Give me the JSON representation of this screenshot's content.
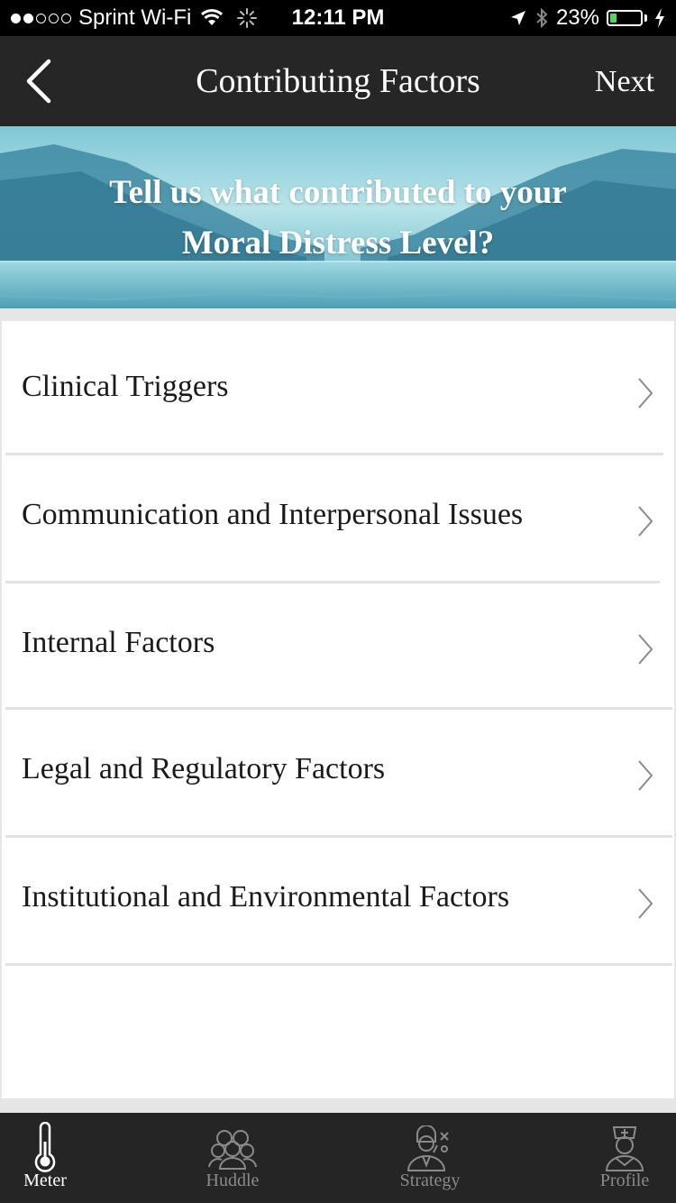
{
  "status_bar": {
    "carrier": "Sprint Wi-Fi",
    "time": "12:11 PM",
    "battery_percent": "23%",
    "battery_level": 0.23,
    "icons": [
      "wifi-icon",
      "activity-spinner-icon",
      "location-arrow-icon",
      "bluetooth-icon",
      "battery-icon",
      "charging-bolt-icon"
    ]
  },
  "nav": {
    "title": "Contributing Factors",
    "next_label": "Next",
    "back_icon": "chevron-left-icon"
  },
  "hero": {
    "line1": "Tell us what contributed to your",
    "line2": "Moral Distress Level?"
  },
  "list": {
    "items": [
      {
        "label": "Clinical Triggers"
      },
      {
        "label": "Communication and Interpersonal Issues"
      },
      {
        "label": "Internal Factors"
      },
      {
        "label": "Legal and Regulatory Factors"
      },
      {
        "label": "Institutional and Environmental Factors"
      }
    ]
  },
  "tabs": [
    {
      "label": "Meter",
      "icon": "thermometer-icon",
      "active": true
    },
    {
      "label": "Huddle",
      "icon": "group-icon",
      "active": false
    },
    {
      "label": "Strategy",
      "icon": "strategy-person-icon",
      "active": false
    },
    {
      "label": "Profile",
      "icon": "nurse-icon",
      "active": false
    }
  ],
  "colors": {
    "nav_bg": "#262626",
    "tab_bg": "#252525",
    "battery_green": "#4cd964",
    "hero_sky": "#8fd3e0"
  }
}
